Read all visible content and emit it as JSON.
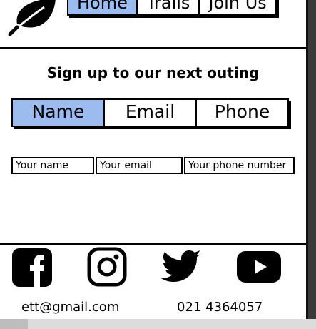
{
  "nav": {
    "items": [
      {
        "label": "Home",
        "active": true
      },
      {
        "label": "Trails",
        "active": false
      },
      {
        "label": "Join Us",
        "active": false
      }
    ]
  },
  "signup": {
    "title": "Sign up to our next outing",
    "tabs": [
      {
        "label": "Name",
        "active": true
      },
      {
        "label": "Email",
        "active": false
      },
      {
        "label": "Phone",
        "active": false
      }
    ],
    "fields": {
      "name_placeholder": "Your name",
      "email_placeholder": "Your email",
      "phone_placeholder": "Your phone number"
    }
  },
  "footer": {
    "social": [
      "facebook-icon",
      "instagram-icon",
      "twitter-icon",
      "youtube-icon"
    ],
    "email": "ett@gmail.com",
    "phone": "021 4364057"
  },
  "colors": {
    "accent": "#9cbcf0",
    "border": "#000000",
    "background": "#ffffff"
  }
}
